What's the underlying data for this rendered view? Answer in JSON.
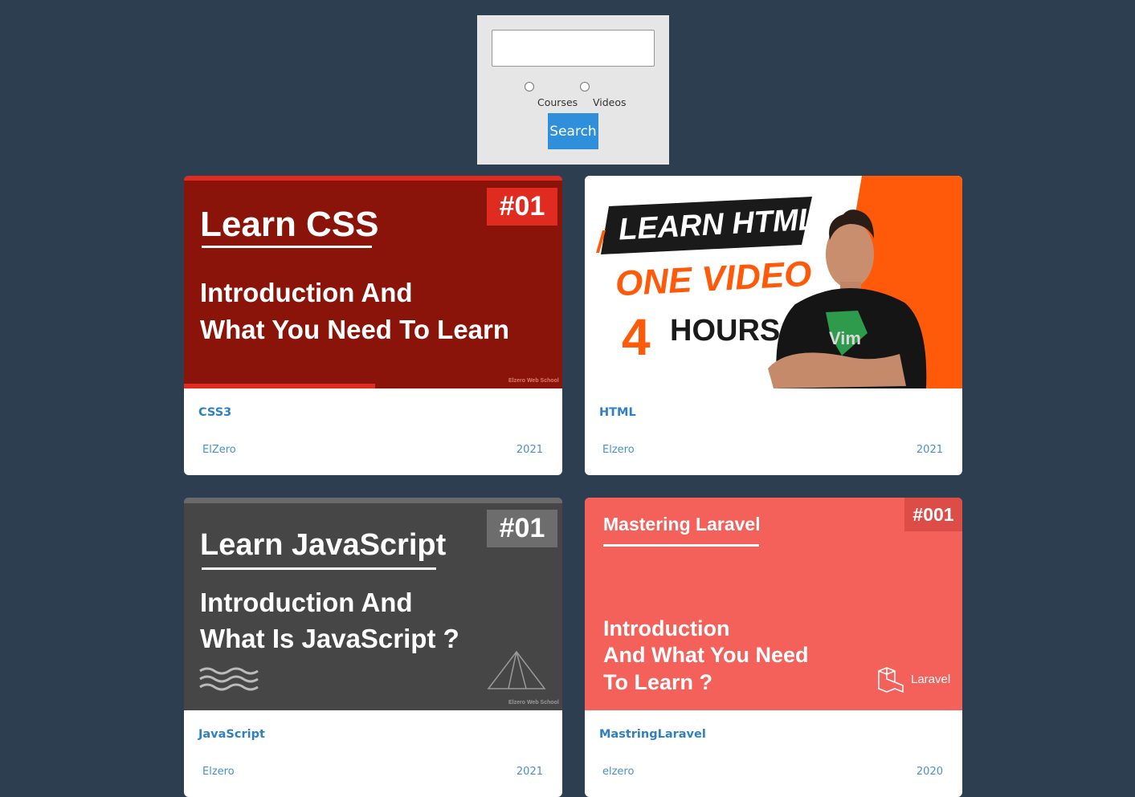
{
  "search": {
    "input_value": "",
    "options": [
      "Courses",
      "Videos"
    ],
    "button_label": "Search"
  },
  "colors": {
    "page_background": "#2c3e50",
    "accent": "#2f8fdb",
    "css_thumb": "#8a1409",
    "js_thumb": "#464646",
    "laravel_thumb": "#f4605a",
    "html_orange": "#ff5a0a"
  },
  "cards": [
    {
      "title": "CSS3",
      "author": "ElZero",
      "year": "2021",
      "thumb": {
        "heading": "Learn CSS",
        "badge": "#01",
        "line1": "Introduction And",
        "line2": "What You Need To Learn",
        "footer": "Elzero Web School"
      }
    },
    {
      "title": "HTML",
      "author": "Elzero",
      "year": "2021",
      "thumb": {
        "heading": "LEARN HTML",
        "line1": "ONE VIDEO",
        "number": "4",
        "line2": "HOURS",
        "shirt": "Vim"
      }
    },
    {
      "title": "JavaScript",
      "author": "Elzero",
      "year": "2021",
      "thumb": {
        "heading": "Learn JavaScript",
        "badge": "#01",
        "line1": "Introduction And",
        "line2": "What Is JavaScript ?",
        "footer": "Elzero Web School"
      }
    },
    {
      "title": "MastringLaravel",
      "author": "elzero",
      "year": "2020",
      "thumb": {
        "heading": "Mastering Laravel",
        "badge": "#001",
        "line1": "Introduction",
        "line2": "And What You Need",
        "line3": "To Learn ?",
        "brand": "Laravel"
      }
    }
  ]
}
